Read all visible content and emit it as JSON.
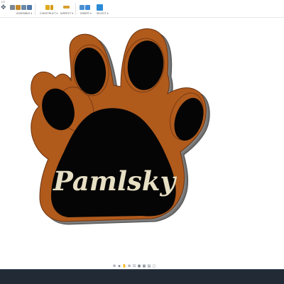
{
  "app": {
    "tab_label": "ES"
  },
  "toolbar": {
    "assemble_label": "ASSEMBLE ▾",
    "construct_label": "CONSTRUCT ▾",
    "inspect_label": "INSPECT ▾",
    "insert_label": "INSERT ▾",
    "select_label": "SELECT ▾"
  },
  "model": {
    "engraved_text": "Pamlsky"
  },
  "colors": {
    "accent": "#2a8ad6",
    "wall": "#6f6f6f",
    "rim": "#b05a1c",
    "fill": "#050505",
    "text": "#e7dfc4",
    "taskbar": "#222a35"
  }
}
